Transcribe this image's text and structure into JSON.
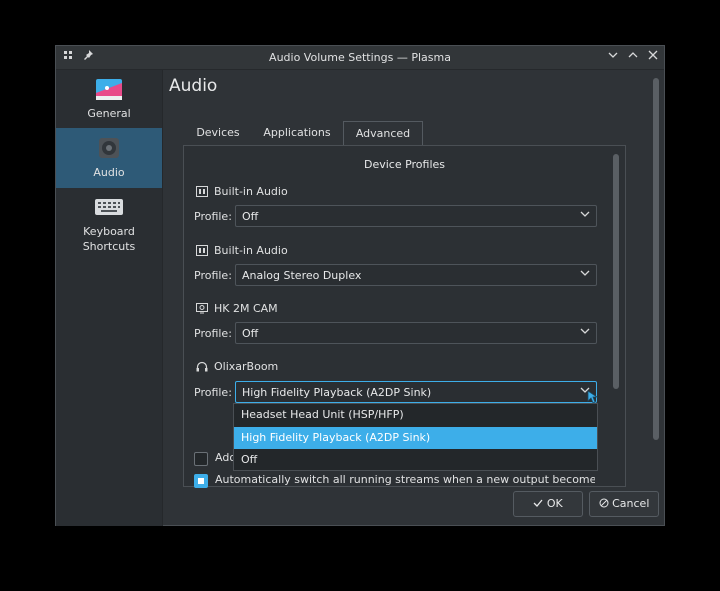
{
  "window": {
    "title": "Audio Volume Settings — Plasma",
    "icons": {
      "app": "app-grid-icon",
      "pin": "pin-icon",
      "minimize": "chevron-down-icon",
      "maximize": "chevron-up-icon",
      "close": "close-icon"
    }
  },
  "sidebar": {
    "items": [
      {
        "label": "General",
        "icon": "general-settings-icon"
      },
      {
        "label": "Audio",
        "icon": "speaker-icon"
      },
      {
        "label": "Keyboard Shortcuts",
        "icon": "keyboard-icon"
      }
    ]
  },
  "page": {
    "title": "Audio"
  },
  "tabs": [
    "Devices",
    "Applications",
    "Advanced"
  ],
  "section": {
    "title": "Device Profiles"
  },
  "devices": [
    {
      "name": "Built-in Audio",
      "profile_label": "Profile:",
      "profile": "Off"
    },
    {
      "name": "Built-in Audio",
      "profile_label": "Profile:",
      "profile": "Analog Stereo Duplex"
    },
    {
      "name": "HK 2M CAM",
      "profile_label": "Profile:",
      "profile": "Off"
    },
    {
      "name": "OlixarBoom",
      "profile_label": "Profile:",
      "profile": "High Fidelity Playback (A2DP Sink)"
    }
  ],
  "dropdown": {
    "options": [
      "Headset Head Unit (HSP/HFP)",
      "High Fidelity Playback (A2DP Sink)",
      "Off"
    ],
    "selected_index": 1
  },
  "options": {
    "add_label": "Ado",
    "add_checked": false,
    "auto_switch_label": "Automatically switch all running streams when a new output becomes a...",
    "auto_switch_checked": true
  },
  "buttons": {
    "ok": "OK",
    "cancel": "Cancel"
  },
  "colors": {
    "accent": "#3daee9",
    "window_bg": "#2f3337",
    "sidebar_active": "#2e5a77"
  }
}
